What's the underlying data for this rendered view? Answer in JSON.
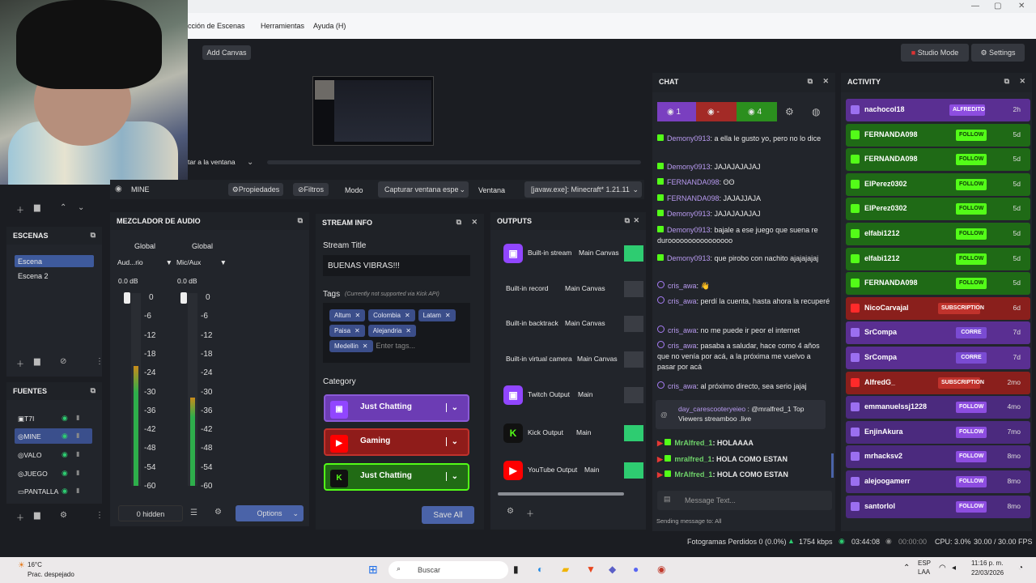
{
  "window": {
    "min": "—",
    "max": "▢",
    "close": "✕"
  },
  "menu": {
    "scenes_menu": "cción de Escenas",
    "tools": "Herramientas",
    "help": "Ayuda (H)"
  },
  "toolbar": {
    "add_canvas": "Add Canvas",
    "studio_mode": "Studio Mode",
    "settings": "Settings"
  },
  "source_bar": {
    "window_label": "tar a la ventana",
    "source_name": "MINE",
    "properties": "Propiedades",
    "filters": "Filtros",
    "mode": "Modo",
    "mode_value": "Capturar ventana espe",
    "window": "Ventana",
    "window_value": "[javaw.exe]: Minecraft* 1.21.11"
  },
  "scenes": {
    "title": "ESCENAS",
    "items": [
      "Escena",
      "Escena 2"
    ]
  },
  "sources": {
    "title": "FUENTES",
    "items": [
      "T7I",
      "MINE",
      "VALO",
      "JUEGO",
      "PANTALLA"
    ]
  },
  "mixer": {
    "title": "MEZCLADOR DE AUDIO",
    "channels": [
      {
        "name": "Global",
        "device": "Aud...rio",
        "db": "0.0 dB",
        "level": 0.62
      },
      {
        "name": "Global",
        "device": "Mic/Aux",
        "db": "0.0 dB",
        "level": 0.46
      }
    ],
    "scale": [
      "0",
      "-6",
      "-12",
      "-18",
      "-24",
      "-30",
      "-36",
      "-42",
      "-48",
      "-54",
      "-60"
    ],
    "hidden": "0 hidden",
    "options": "Options"
  },
  "stream_info": {
    "title": "STREAM INFO",
    "stream_title_label": "Stream Title",
    "stream_title": "BUENAS VIBRAS!!!",
    "tags_label": "Tags",
    "tags_note": "(Currently not supported via Kick API)",
    "tags": [
      "Altum",
      "Colombia",
      "Latam",
      "Paisa",
      "Alejandria",
      "Medellin"
    ],
    "tags_placeholder": "Enter tags...",
    "category_label": "Category",
    "categories": [
      {
        "platform": "twitch",
        "name": "Just Chatting",
        "color": "#6c3cb4",
        "icon": "twitch-icon"
      },
      {
        "platform": "youtube",
        "name": "Gaming",
        "color": "#b8221f",
        "icon": "youtube-icon"
      },
      {
        "platform": "kick",
        "name": "Just Chatting",
        "color": "#2a8a1a",
        "icon": "kick-icon"
      }
    ],
    "save": "Save All"
  },
  "outputs": {
    "title": "OUTPUTS",
    "rows": [
      {
        "name": "Built-in stream",
        "canvas": "Main Canvas",
        "icon": "twitch-icon",
        "color": "#9146ff",
        "toggle": "#2ecc71"
      },
      {
        "name": "Built-in record",
        "canvas": "Main Canvas",
        "icon": "",
        "color": "",
        "toggle": "#3a3d44"
      },
      {
        "name": "Built-in backtrack",
        "canvas": "Main Canvas",
        "icon": "",
        "color": "",
        "toggle": "#3a3d44"
      },
      {
        "name": "Built-in virtual camera",
        "canvas": "Main Canvas",
        "icon": "",
        "color": "",
        "toggle": "#3a3d44"
      },
      {
        "name": "Twitch Output",
        "canvas": "Main",
        "icon": "twitch-icon",
        "color": "#9146ff",
        "toggle": "#3a3d44"
      },
      {
        "name": "Kick Output",
        "canvas": "Main",
        "icon": "kick-icon",
        "color": "#53fc18",
        "toggle": "#2ecc71"
      },
      {
        "name": "YouTube Output",
        "canvas": "Main",
        "icon": "youtube-icon",
        "color": "#ff0000",
        "toggle": "#2ecc71"
      }
    ]
  },
  "chat": {
    "title": "CHAT",
    "counts": [
      "1",
      "-",
      "4"
    ],
    "messages": [
      {
        "p": "kick",
        "user": "Demony0913",
        "text": ": a ella le gusto yo, pero no lo dice"
      },
      {
        "p": "kick",
        "user": "Demony0913",
        "text": ": JAJAJAJAJAJ"
      },
      {
        "p": "kick",
        "user": "FERNANDA098",
        "text": ": ʘʘ"
      },
      {
        "p": "kick",
        "user": "FERNANDA098",
        "text": ": JAJAJJAJA"
      },
      {
        "p": "kick",
        "user": "Demony0913",
        "text": ": JAJAJAJAJAJ"
      },
      {
        "p": "kick",
        "user": "Demony0913",
        "text": ": bajale a ese juego que suena re duroooooooooooooooo"
      },
      {
        "p": "kick",
        "user": "Demony0913",
        "text": ": que pirobo con nachito ajajajajaj"
      },
      {
        "p": "twitch",
        "user": "cris_awa",
        "text": ": 👋"
      },
      {
        "p": "twitch",
        "user": "cris_awa",
        "text": ": perdí la cuenta, hasta ahora la recuperé"
      },
      {
        "p": "twitch",
        "user": "cris_awa",
        "text": ": no me puede ir peor el internet"
      },
      {
        "p": "twitch",
        "user": "cris_awa",
        "text": ": pasaba a saludar, hace como 4 años que no venía por acá, a la próxima me vuelvo a pasar por acá"
      },
      {
        "p": "twitch",
        "user": "cris_awa",
        "text": ": al próximo directo, sea serio jajaj"
      }
    ],
    "mention": {
      "user": "day_carescooteryeieo",
      "text": ": @mralfred_1 Top Viewers streamboo .live"
    },
    "yt_messages": [
      {
        "user": "MrAlfred_1",
        "text": ": HOLAAAA"
      },
      {
        "user": "mralfred_1",
        "text": ": HOLA COMO ESTAN"
      },
      {
        "user": "MrAlfred_1",
        "text": ": HOLA COMO ESTAN"
      }
    ],
    "placeholder": "Message Text...",
    "sending": "Sending message to: All"
  },
  "activity": {
    "title": "ACTIVITY",
    "rows": [
      {
        "user": "nachocol18",
        "badge": "ALFREDITO",
        "time": "2h",
        "kind": "twitch"
      },
      {
        "user": "FERNANDA098",
        "badge": "FOLLOW",
        "time": "5d",
        "kind": "kick"
      },
      {
        "user": "FERNANDA098",
        "badge": "FOLLOW",
        "time": "5d",
        "kind": "kick"
      },
      {
        "user": "ElPerez0302",
        "badge": "FOLLOW",
        "time": "5d",
        "kind": "kick"
      },
      {
        "user": "ElPerez0302",
        "badge": "FOLLOW",
        "time": "5d",
        "kind": "kick"
      },
      {
        "user": "elfabi1212",
        "badge": "FOLLOW",
        "time": "5d",
        "kind": "kick"
      },
      {
        "user": "elfabi1212",
        "badge": "FOLLOW",
        "time": "5d",
        "kind": "kick"
      },
      {
        "user": "FERNANDA098",
        "badge": "FOLLOW",
        "time": "5d",
        "kind": "kick"
      },
      {
        "user": "NicoCarvajal",
        "badge": "SUBSCRIPTION",
        "time": "6d",
        "kind": "youtube"
      },
      {
        "user": "SrCompa",
        "badge": "CORRE",
        "time": "7d",
        "kind": "twitch"
      },
      {
        "user": "SrCompa",
        "badge": "CORRE",
        "time": "7d",
        "kind": "twitch"
      },
      {
        "user": "AlfredG_",
        "badge": "SUBSCRIPTION",
        "time": "2mo",
        "kind": "youtube"
      },
      {
        "user": "emmanuelssj1228",
        "badge": "FOLLOW",
        "time": "4mo",
        "kind": "twitch"
      },
      {
        "user": "EnjinAkura",
        "badge": "FOLLOW",
        "time": "7mo",
        "kind": "twitch"
      },
      {
        "user": "mrhacksv2",
        "badge": "FOLLOW",
        "time": "8mo",
        "kind": "twitch"
      },
      {
        "user": "alejoogamerr",
        "badge": "FOLLOW",
        "time": "8mo",
        "kind": "twitch"
      },
      {
        "user": "santorlol",
        "badge": "FOLLOW",
        "time": "8mo",
        "kind": "twitch"
      }
    ]
  },
  "status": {
    "dropped": "Fotogramas Perdidos 0 (0.0%)",
    "bitrate": "1754 kbps",
    "live_time": "03:44:08",
    "rec_time": "00:00:00",
    "cpu": "CPU: 3.0%",
    "fps": "30.00 / 30.00 FPS"
  },
  "taskbar": {
    "temp": "16°C",
    "weather": "Prac. despejado",
    "search": "Buscar",
    "lang1": "ESP",
    "lang2": "LAA",
    "time": "11:16 p. m.",
    "date": "22/03/2026"
  }
}
